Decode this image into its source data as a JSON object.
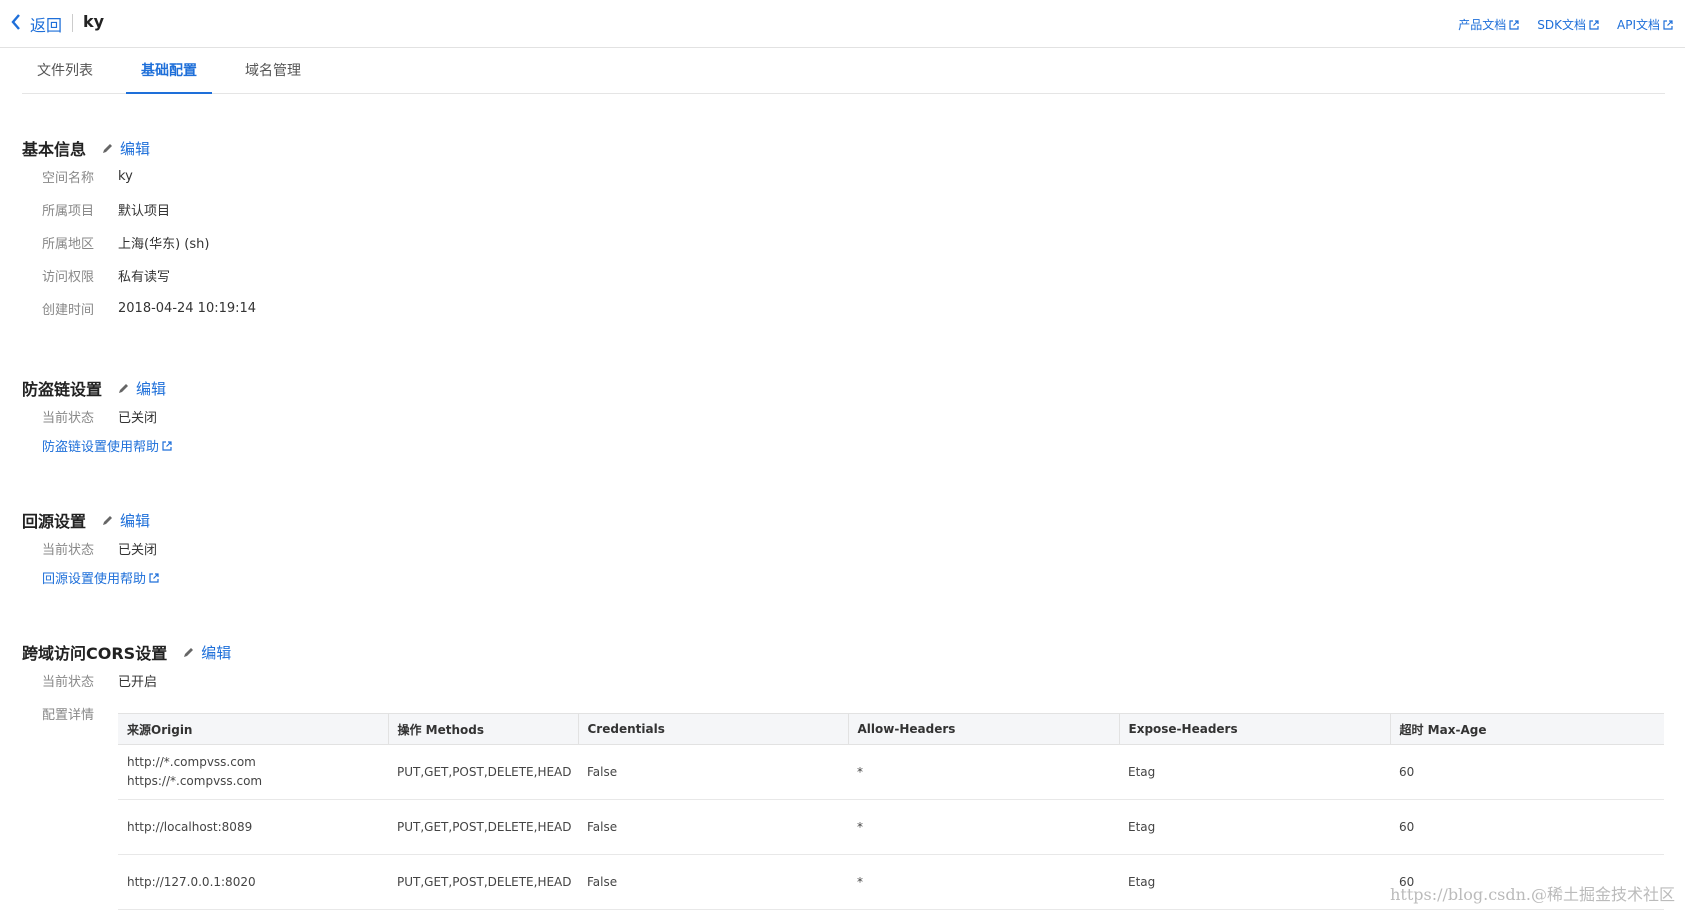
{
  "header": {
    "back_label": "返回",
    "bucket_name": "ky",
    "doc_links": [
      "产品文档",
      "SDK文档",
      "API文档"
    ]
  },
  "tabs": [
    {
      "label": "文件列表",
      "active": false
    },
    {
      "label": "基础配置",
      "active": true
    },
    {
      "label": "域名管理",
      "active": false
    }
  ],
  "edit_label": "编辑",
  "basic_info": {
    "title": "基本信息",
    "rows": [
      {
        "label": "空间名称",
        "value": "ky"
      },
      {
        "label": "所属项目",
        "value": "默认项目"
      },
      {
        "label": "所属地区",
        "value": "上海(华东) (sh)"
      },
      {
        "label": "访问权限",
        "value": "私有读写"
      },
      {
        "label": "创建时间",
        "value": "2018-04-24 10:19:14"
      }
    ]
  },
  "hotlink": {
    "title": "防盗链设置",
    "status_label": "当前状态",
    "status": "已关闭",
    "help": "防盗链设置使用帮助"
  },
  "origin": {
    "title": "回源设置",
    "status_label": "当前状态",
    "status": "已关闭",
    "help": "回源设置使用帮助"
  },
  "cors": {
    "title": "跨域访问CORS设置",
    "status_label": "当前状态",
    "status": "已开启",
    "detail_label": "配置详情",
    "columns": [
      "来源Origin",
      "操作 Methods",
      "Credentials",
      "Allow-Headers",
      "Expose-Headers",
      "超时 Max-Age"
    ],
    "rows": [
      {
        "origin": [
          "http://*.compvss.com",
          "https://*.compvss.com"
        ],
        "methods": "PUT,GET,POST,DELETE,HEAD",
        "credentials": "False",
        "allow_headers": "*",
        "expose_headers": "Etag",
        "max_age": "60"
      },
      {
        "origin": [
          "http://localhost:8089"
        ],
        "methods": "PUT,GET,POST,DELETE,HEAD",
        "credentials": "False",
        "allow_headers": "*",
        "expose_headers": "Etag",
        "max_age": "60"
      },
      {
        "origin": [
          "http://127.0.0.1:8020"
        ],
        "methods": "PUT,GET,POST,DELETE,HEAD",
        "credentials": "False",
        "allow_headers": "*",
        "expose_headers": "Etag",
        "max_age": "60"
      }
    ]
  },
  "watermark": "https://blog.csdn.@稀土掘金技术社区",
  "colors": {
    "accent": "#1e6fd9"
  }
}
